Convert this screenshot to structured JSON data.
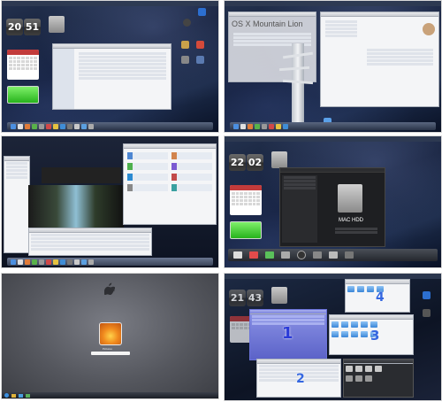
{
  "collage": {
    "panel_1": {
      "clock_hour": "20",
      "clock_minute": "51",
      "accent": "#3a6fd8"
    },
    "panel_2": {
      "title": "OS X Mountain Lion"
    },
    "panel_3": {},
    "panel_4": {
      "clock_hour": "22",
      "clock_minute": "02",
      "drive_name": "MAC HDD"
    },
    "panel_5": {
      "user_label": "Pictures",
      "apple_logo": "apple-logo"
    },
    "panel_6": {
      "clock_hour": "21",
      "clock_minute": "43",
      "window_numbers": [
        "1",
        "2",
        "3",
        "4"
      ]
    }
  },
  "colors": {
    "desktop": "#0e1830",
    "battery": "#27b31c",
    "calendar_header": "#c23b3b",
    "login_bg": "#5a5c63",
    "highlight": "#3567e0"
  }
}
